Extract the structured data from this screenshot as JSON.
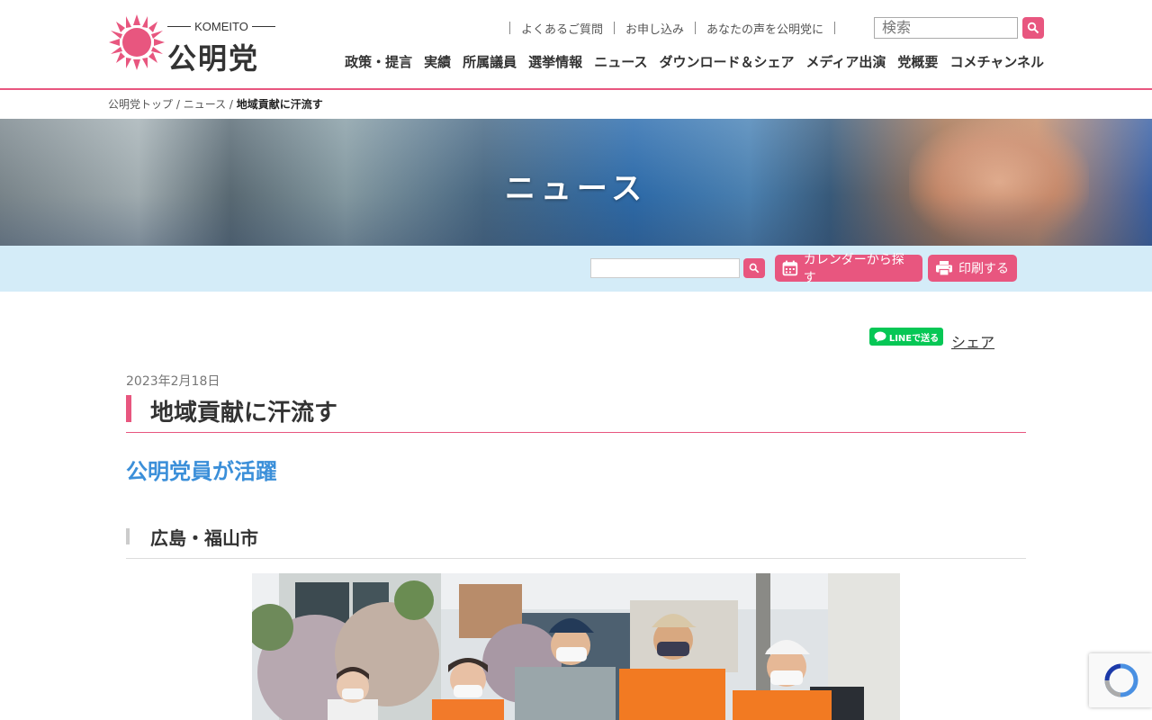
{
  "logo": {
    "romaji": "KOMEITO",
    "kanji": "公明党"
  },
  "utility_links": [
    "よくあるご質問",
    "お申し込み",
    "あなたの声を公明党に"
  ],
  "search": {
    "placeholder": "検索"
  },
  "nav": [
    "政策・提言",
    "実績",
    "所属議員",
    "選挙情報",
    "ニュース",
    "ダウンロード＆シェア",
    "メディア出演",
    "党概要",
    "コメチャンネル"
  ],
  "breadcrumb": {
    "home": "公明党トップ",
    "sep": " / ",
    "section": "ニュース",
    "current": "地域貢献に汗流す"
  },
  "hero": {
    "title": "ニュース"
  },
  "toolbar": {
    "calendar_label": "カレンダーから探す",
    "print_label": "印刷する"
  },
  "share": {
    "line_label": "LINEで送る",
    "share_label": "シェア"
  },
  "article": {
    "date": "2023年2月18日",
    "title": "地域貢献に汗流す",
    "subtitle": "公明党員が活躍",
    "section_heading": "広島・福山市"
  },
  "colors": {
    "brand_pink": "#e8567f",
    "accent_blue": "#3b8fd9",
    "toolbar_bg": "#d4ecf8",
    "line_green": "#06c755"
  },
  "icons": [
    "sun-logo-icon",
    "search-icon",
    "calendar-icon",
    "printer-icon",
    "line-icon",
    "recaptcha-icon"
  ]
}
